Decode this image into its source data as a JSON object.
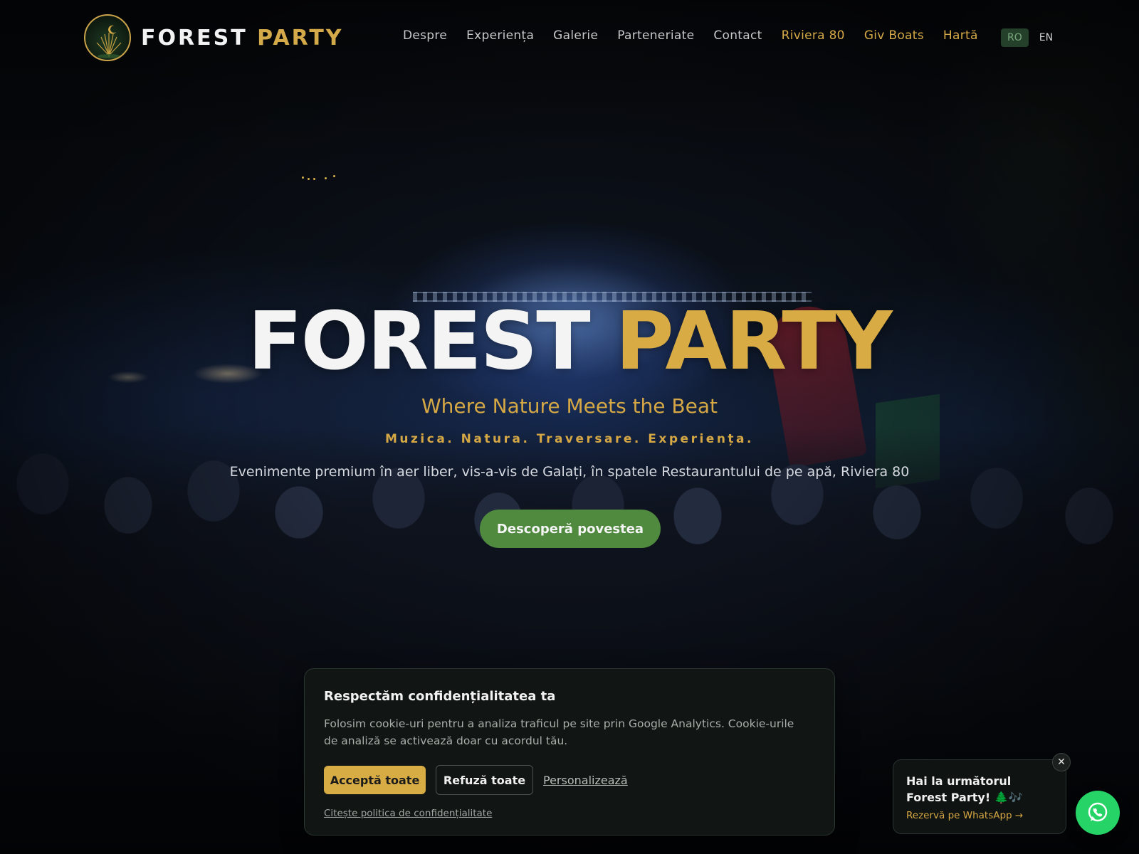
{
  "brand": {
    "name_part1": "FOREST",
    "name_part2": "PARTY"
  },
  "nav": {
    "items": [
      {
        "label": "Despre",
        "accent": false
      },
      {
        "label": "Experiența",
        "accent": false
      },
      {
        "label": "Galerie",
        "accent": false
      },
      {
        "label": "Parteneriate",
        "accent": false
      },
      {
        "label": "Contact",
        "accent": false
      },
      {
        "label": "Riviera 80",
        "accent": true
      },
      {
        "label": "Giv Boats",
        "accent": true
      },
      {
        "label": "Hartă",
        "accent": true
      }
    ]
  },
  "language": {
    "active": "RO",
    "other": "EN"
  },
  "hero": {
    "title_part1": "FOREST",
    "title_part2": "PARTY",
    "tagline": "Where Nature Meets the Beat",
    "subtagline": "Muzica. Natura. Traversare. Experiența.",
    "description": "Evenimente premium în aer liber, vis-a-vis de Galați, în spatele Restaurantului de pe apă, Riviera 80",
    "cta_label": "Descoperă povestea"
  },
  "cookie_banner": {
    "title": "Respectăm confidențialitatea ta",
    "text": "Folosim cookie-uri pentru a analiza traficul pe site prin Google Analytics. Cookie-urile de analiză se activează doar cu acordul tău.",
    "accept_label": "Acceptă toate",
    "refuse_label": "Refuză toate",
    "customize_label": "Personalizează",
    "policy_link": "Citește politica de confidențialitate"
  },
  "whatsapp_popup": {
    "title": "Hai la următorul Forest Party! 🌲🎶",
    "link": "Rezervă pe WhatsApp →",
    "close_icon": "close-icon",
    "button_icon": "whatsapp-icon"
  },
  "colors": {
    "gold_accent": "#d8ab45",
    "green_cta": "#4f8a3e",
    "whatsapp_green": "#25d366",
    "lang_active_bg": "#24402a"
  }
}
